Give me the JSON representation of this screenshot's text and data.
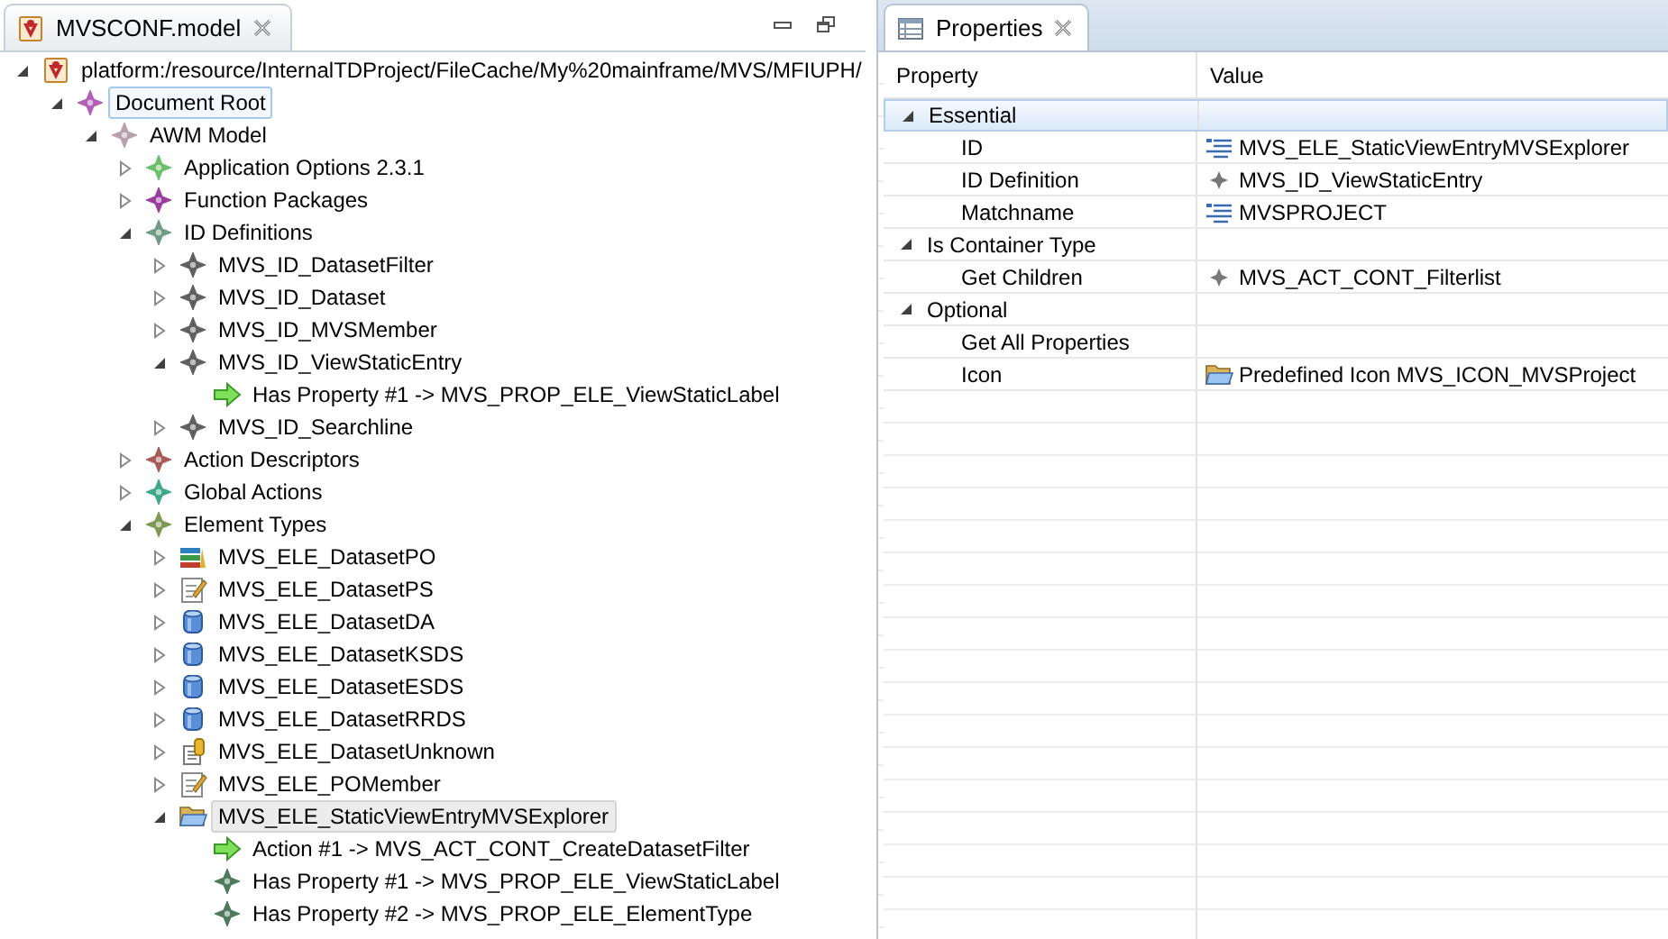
{
  "editor": {
    "tab": {
      "title": "MVSCONF.model"
    },
    "tree": [
      {
        "label": "platform:/resource/InternalTDProject/FileCache/My%20mainframe/MVS/MFIUPH/",
        "kind": "model",
        "expanded": true,
        "selected": false,
        "focused": false,
        "children": [
          {
            "label": "Document Root",
            "kind": "diamond",
            "color": "#b35fb8",
            "expanded": true,
            "selected": false,
            "focused": true,
            "children": [
              {
                "label": "AWM Model",
                "kind": "diamond",
                "color": "#b8a0ac",
                "expanded": true,
                "selected": false,
                "focused": false,
                "children": [
                  {
                    "label": "Application Options 2.3.1",
                    "kind": "diamond",
                    "color": "#6cc06c",
                    "expanded": false,
                    "selected": false,
                    "focused": false
                  },
                  {
                    "label": "Function Packages",
                    "kind": "diamond",
                    "color": "#9c3c9c",
                    "expanded": false,
                    "selected": false,
                    "focused": false
                  },
                  {
                    "label": "ID Definitions",
                    "kind": "diamond",
                    "color": "#6e9c84",
                    "expanded": true,
                    "selected": false,
                    "focused": false,
                    "children": [
                      {
                        "label": "MVS_ID_DatasetFilter",
                        "kind": "diamond",
                        "color": "#606060",
                        "expanded": false,
                        "selected": false,
                        "focused": false
                      },
                      {
                        "label": "MVS_ID_Dataset",
                        "kind": "diamond",
                        "color": "#606060",
                        "expanded": false,
                        "selected": false,
                        "focused": false
                      },
                      {
                        "label": "MVS_ID_MVSMember",
                        "kind": "diamond",
                        "color": "#606060",
                        "expanded": false,
                        "selected": false,
                        "focused": false
                      },
                      {
                        "label": "MVS_ID_ViewStaticEntry",
                        "kind": "diamond",
                        "color": "#606060",
                        "expanded": true,
                        "selected": false,
                        "focused": false,
                        "children": [
                          {
                            "label": "Has Property #1 -> MVS_PROP_ELE_ViewStaticLabel",
                            "kind": "arrow",
                            "selected": false,
                            "focused": false
                          }
                        ]
                      },
                      {
                        "label": "MVS_ID_Searchline",
                        "kind": "diamond",
                        "color": "#606060",
                        "expanded": false,
                        "selected": false,
                        "focused": false
                      }
                    ]
                  },
                  {
                    "label": "Action Descriptors",
                    "kind": "diamond",
                    "color": "#a85a5a",
                    "expanded": false,
                    "selected": false,
                    "focused": false
                  },
                  {
                    "label": "Global Actions",
                    "kind": "diamond",
                    "color": "#3fa88a",
                    "expanded": false,
                    "selected": false,
                    "focused": false
                  },
                  {
                    "label": "Element Types",
                    "kind": "diamond",
                    "color": "#7f9a52",
                    "expanded": true,
                    "selected": false,
                    "focused": false,
                    "children": [
                      {
                        "label": "MVS_ELE_DatasetPO",
                        "kind": "books",
                        "expanded": false,
                        "selected": false,
                        "focused": false
                      },
                      {
                        "label": "MVS_ELE_DatasetPS",
                        "kind": "edit",
                        "expanded": false,
                        "selected": false,
                        "focused": false
                      },
                      {
                        "label": "MVS_ELE_DatasetDA",
                        "kind": "cylinder",
                        "expanded": false,
                        "selected": false,
                        "focused": false
                      },
                      {
                        "label": "MVS_ELE_DatasetKSDS",
                        "kind": "cylinder",
                        "expanded": false,
                        "selected": false,
                        "focused": false
                      },
                      {
                        "label": "MVS_ELE_DatasetESDS",
                        "kind": "cylinder",
                        "expanded": false,
                        "selected": false,
                        "focused": false
                      },
                      {
                        "label": "MVS_ELE_DatasetRRDS",
                        "kind": "cylinder",
                        "expanded": false,
                        "selected": false,
                        "focused": false
                      },
                      {
                        "label": "MVS_ELE_DatasetUnknown",
                        "kind": "stack",
                        "expanded": false,
                        "selected": false,
                        "focused": false
                      },
                      {
                        "label": "MVS_ELE_POMember",
                        "kind": "edit",
                        "expanded": false,
                        "selected": false,
                        "focused": false
                      },
                      {
                        "label": "MVS_ELE_StaticViewEntryMVSExplorer",
                        "kind": "folder",
                        "expanded": true,
                        "selected": true,
                        "focused": false,
                        "children": [
                          {
                            "label": "Action #1  -> MVS_ACT_CONT_CreateDatasetFilter",
                            "kind": "arrow",
                            "selected": false,
                            "focused": false
                          },
                          {
                            "label": "Has Property #1 -> MVS_PROP_ELE_ViewStaticLabel",
                            "kind": "diamond",
                            "color": "#4d7a5c",
                            "selected": false,
                            "focused": false
                          },
                          {
                            "label": "Has Property #2 -> MVS_PROP_ELE_ElementType",
                            "kind": "diamond",
                            "color": "#4d7a5c",
                            "selected": false,
                            "focused": false
                          }
                        ]
                      }
                    ]
                  }
                ]
              }
            ]
          }
        ]
      }
    ]
  },
  "properties": {
    "tab": {
      "title": "Properties"
    },
    "columns": [
      "Property",
      "Value"
    ],
    "rows": [
      {
        "kind": "category",
        "label": "Essential",
        "expanded": true,
        "selected": true
      },
      {
        "kind": "text-property",
        "label": "ID",
        "value": "MVS_ELE_StaticViewEntryMVSExplorer",
        "selected": false
      },
      {
        "kind": "reference-property",
        "label": "ID Definition",
        "value": "MVS_ID_ViewStaticEntry",
        "selected": false
      },
      {
        "kind": "text-property",
        "label": "Matchname",
        "value": "MVSPROJECT",
        "selected": false
      },
      {
        "kind": "category",
        "label": "Is Container Type",
        "expanded": true,
        "selected": false
      },
      {
        "kind": "reference-property",
        "label": "Get Children",
        "value": "MVS_ACT_CONT_Filterlist",
        "selected": false
      },
      {
        "kind": "category",
        "label": "Optional",
        "expanded": true,
        "selected": false
      },
      {
        "kind": "empty-property",
        "label": "Get All Properties",
        "selected": false
      },
      {
        "kind": "icon-property",
        "label": "Icon",
        "value": "Predefined Icon MVS_ICON_MVSProject",
        "selected": false
      }
    ]
  }
}
